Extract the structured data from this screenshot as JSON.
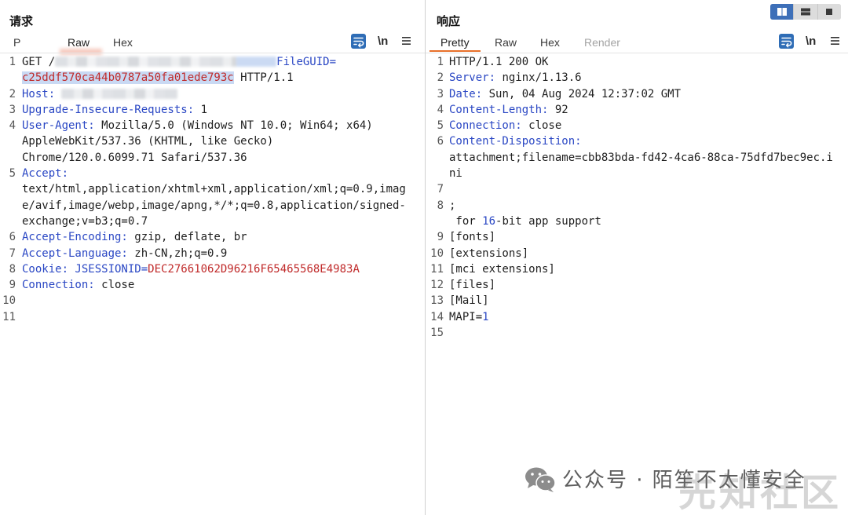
{
  "colors": {
    "key_blue": "#2a47c4",
    "value_red": "#c02a2a",
    "text": "#1e1e1e",
    "line_number": "#555555",
    "active_tab_underline": "#e8702a",
    "selection": "#c9d9f3",
    "toggle_active": "#3d6fb8",
    "toolbar_blue": "#2f6db6",
    "disabled_tab": "#a3a3a3"
  },
  "layout_toggle": {
    "options": [
      {
        "icon": "split-columns-icon",
        "active": true
      },
      {
        "icon": "split-rows-icon",
        "active": false
      },
      {
        "icon": "single-pane-icon",
        "active": false
      }
    ]
  },
  "request": {
    "title": "请求",
    "tabs": [
      {
        "label": "P",
        "active": false
      },
      {
        "label": "Raw",
        "active": true
      },
      {
        "label": "Hex",
        "active": false
      }
    ],
    "toolbar": {
      "wrap_icon": "wrap-lines-icon",
      "newline_label": "\\n",
      "menu_icon": "hamburger-menu-icon"
    },
    "lines": [
      {
        "n": "1",
        "s": [
          {
            "t": "GET /",
            "c": "plain"
          },
          {
            "c": "redacted"
          },
          {
            "t": "FileGUID=",
            "c": "blue"
          }
        ]
      },
      {
        "n": "",
        "s": [
          {
            "t": "c25ddf570ca44b0787a50fa01ede793c",
            "c": "red",
            "selected": true
          },
          {
            "t": " HTTP/1.1",
            "c": "plain"
          }
        ]
      },
      {
        "n": "2",
        "s": [
          {
            "t": "Host:",
            "c": "blue"
          },
          {
            "c": "redacted"
          }
        ]
      },
      {
        "n": "3",
        "s": [
          {
            "t": "Upgrade-Insecure-Requests:",
            "c": "blue"
          },
          {
            "t": " 1",
            "c": "plain"
          }
        ]
      },
      {
        "n": "4",
        "s": [
          {
            "t": "User-Agent:",
            "c": "blue"
          },
          {
            "t": " Mozilla/5.0 (Windows NT 10.0; Win64; x64)",
            "c": "plain"
          }
        ]
      },
      {
        "n": "",
        "s": [
          {
            "t": "AppleWebKit/537.36 (KHTML, like Gecko)",
            "c": "plain"
          }
        ]
      },
      {
        "n": "",
        "s": [
          {
            "t": "Chrome/120.0.6099.71 Safari/537.36",
            "c": "plain"
          }
        ]
      },
      {
        "n": "5",
        "s": [
          {
            "t": "Accept:",
            "c": "blue"
          }
        ]
      },
      {
        "n": "",
        "s": [
          {
            "t": "text/html,application/xhtml+xml,application/xml;q=0.9,imag",
            "c": "plain"
          }
        ]
      },
      {
        "n": "",
        "s": [
          {
            "t": "e/avif,image/webp,image/apng,*/*;q=0.8,application/signed-",
            "c": "plain"
          }
        ]
      },
      {
        "n": "",
        "s": [
          {
            "t": "exchange;v=b3;q=0.7",
            "c": "plain"
          }
        ]
      },
      {
        "n": "6",
        "s": [
          {
            "t": "Accept-Encoding:",
            "c": "blue"
          },
          {
            "t": " gzip, deflate, br",
            "c": "plain"
          }
        ]
      },
      {
        "n": "7",
        "s": [
          {
            "t": "Accept-Language:",
            "c": "blue"
          },
          {
            "t": " zh-CN,zh;q=0.9",
            "c": "plain"
          }
        ]
      },
      {
        "n": "8",
        "s": [
          {
            "t": "Cookie: JSESSIONID=",
            "c": "blue"
          },
          {
            "t": "DEC27661062D96216F65465568E4983A",
            "c": "red"
          }
        ]
      },
      {
        "n": "9",
        "s": [
          {
            "t": "Connection:",
            "c": "blue"
          },
          {
            "t": " close",
            "c": "plain"
          }
        ]
      },
      {
        "n": "10",
        "s": []
      },
      {
        "n": "11",
        "s": []
      }
    ]
  },
  "response": {
    "title": "响应",
    "tabs": [
      {
        "label": "Pretty",
        "active": true
      },
      {
        "label": "Raw",
        "active": false
      },
      {
        "label": "Hex",
        "active": false
      },
      {
        "label": "Render",
        "active": false,
        "disabled": true
      }
    ],
    "toolbar": {
      "wrap_icon": "wrap-lines-icon",
      "newline_label": "\\n",
      "menu_icon": "hamburger-menu-icon"
    },
    "lines": [
      {
        "n": "1",
        "s": [
          {
            "t": "HTTP/1.1 200 OK",
            "c": "plain"
          }
        ]
      },
      {
        "n": "2",
        "s": [
          {
            "t": "Server:",
            "c": "blue"
          },
          {
            "t": " nginx/1.13.6",
            "c": "plain"
          }
        ]
      },
      {
        "n": "3",
        "s": [
          {
            "t": "Date:",
            "c": "blue"
          },
          {
            "t": " Sun, 04 Aug 2024 12:37:02 GMT",
            "c": "plain"
          }
        ]
      },
      {
        "n": "4",
        "s": [
          {
            "t": "Content-Length:",
            "c": "blue"
          },
          {
            "t": " 92",
            "c": "plain"
          }
        ]
      },
      {
        "n": "5",
        "s": [
          {
            "t": "Connection:",
            "c": "blue"
          },
          {
            "t": " close",
            "c": "plain"
          }
        ]
      },
      {
        "n": "6",
        "s": [
          {
            "t": "Content-Disposition:",
            "c": "blue"
          }
        ]
      },
      {
        "n": "",
        "s": [
          {
            "t": "attachment;filename=cbb83bda-fd42-4ca6-88ca-75dfd7bec9ec.i",
            "c": "plain"
          }
        ]
      },
      {
        "n": "",
        "s": [
          {
            "t": "ni",
            "c": "plain"
          }
        ]
      },
      {
        "n": "7",
        "s": []
      },
      {
        "n": "8",
        "s": [
          {
            "t": ";",
            "c": "plain"
          }
        ]
      },
      {
        "n": "",
        "s": [
          {
            "t": " for ",
            "c": "plain"
          },
          {
            "t": "16",
            "c": "blue"
          },
          {
            "t": "-bit app support",
            "c": "plain"
          }
        ]
      },
      {
        "n": "9",
        "s": [
          {
            "t": "[fonts]",
            "c": "plain"
          }
        ]
      },
      {
        "n": "10",
        "s": [
          {
            "t": "[extensions]",
            "c": "plain"
          }
        ]
      },
      {
        "n": "11",
        "s": [
          {
            "t": "[mci extensions]",
            "c": "plain"
          }
        ]
      },
      {
        "n": "12",
        "s": [
          {
            "t": "[files]",
            "c": "plain"
          }
        ]
      },
      {
        "n": "13",
        "s": [
          {
            "t": "[Mail]",
            "c": "plain"
          }
        ]
      },
      {
        "n": "14",
        "s": [
          {
            "t": "MAPI=",
            "c": "plain"
          },
          {
            "t": "1",
            "c": "blue"
          }
        ]
      },
      {
        "n": "15",
        "s": []
      }
    ]
  },
  "watermark": {
    "icon": "wechat-icon",
    "account_label": "公众号 · 陌笙不太懂安全",
    "site_logo_text": "先知社区"
  }
}
